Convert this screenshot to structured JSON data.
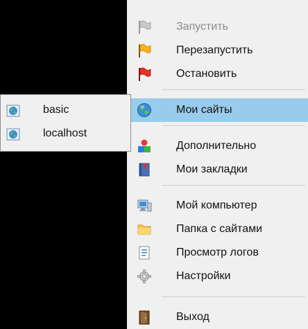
{
  "menu": {
    "items": [
      {
        "label": "Запустить",
        "icon": "white-flag-icon",
        "disabled": true
      },
      {
        "label": "Перезапустить",
        "icon": "yellow-flag-icon"
      },
      {
        "label": "Остановить",
        "icon": "red-flag-icon"
      },
      {
        "label": "Мои сайты",
        "icon": "globe-icon",
        "highlighted": true
      },
      {
        "label": "Дополнительно",
        "icon": "shapes-icon"
      },
      {
        "label": "Мои закладки",
        "icon": "bookmark-book-icon"
      },
      {
        "label": "Мой компьютер",
        "icon": "computer-icon"
      },
      {
        "label": "Папка с сайтами",
        "icon": "folder-icon"
      },
      {
        "label": "Просмотр логов",
        "icon": "log-document-icon"
      },
      {
        "label": "Настройки",
        "icon": "gear-icon"
      },
      {
        "label": "Выход",
        "icon": "exit-door-icon"
      }
    ]
  },
  "submenu": {
    "items": [
      {
        "label": "basic",
        "icon": "site-globe-icon"
      },
      {
        "label": "localhost",
        "icon": "site-globe-icon"
      }
    ]
  },
  "colors": {
    "background": "#000000",
    "menu_bg": "#f0f0f0",
    "highlight": "#99ccec",
    "disabled_text": "#8a8a8a"
  }
}
